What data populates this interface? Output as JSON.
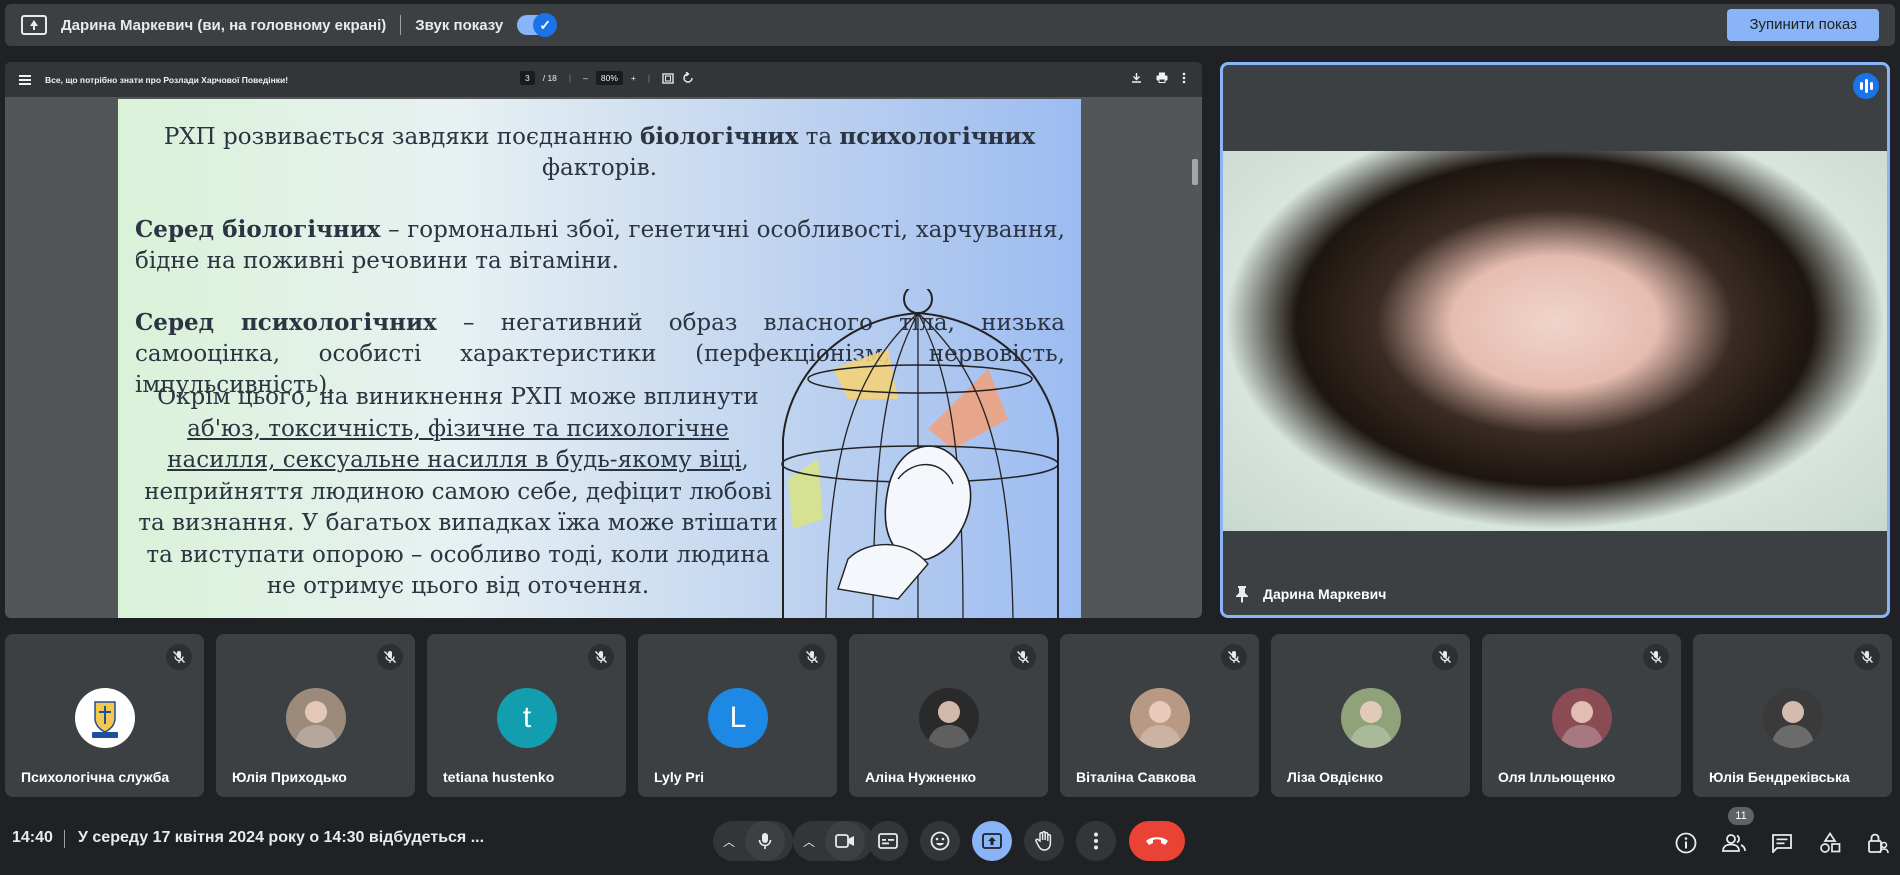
{
  "topbar": {
    "presenter": "Дарина Маркевич (ви, на головному екрані)",
    "sound_label": "Звук показу",
    "stop_label": "Зупинити показ"
  },
  "pdf": {
    "title": "Все, що потрібно знати про Розлади Харчової Поведінки!",
    "page_current": "3",
    "page_total": "/ 18",
    "zoom": "80%",
    "minus": "–",
    "plus": "+",
    "content": {
      "p1_a": "РХП розвивається завдяки поєднанню ",
      "p1_b": "біологічних",
      "p1_c": " та ",
      "p1_d": "психологічних",
      "p1_e": "факторів.",
      "p2_bold": "Серед біологічних",
      "p2_rest": " – гормональні збої, генетичні особливості, харчування, бідне на поживні речовини та вітаміни.",
      "p3_bold": "Серед психологічних",
      "p3_rest": " – негативний образ власного тіла, низька самооцінка, особисті характеристики (перфекціонізм, нервовість, імпульсивність).",
      "p4_a": "Окрім цього, на виникнення РХП може вплинути ",
      "p4_u": "аб'юз, токсичність, фізичне та психологічне насилля, сексуальне насилля в будь-якому віці",
      "p4_b": ", неприйняття людиною самою себе, дефіцит любові та визнання. У багатьох випадках їжа може втішати та виступати опорою – особливо тоді, коли людина не отримує цього від оточення."
    }
  },
  "speaker": {
    "name": "Дарина Маркевич"
  },
  "participants": [
    {
      "name": "Психологічна служба",
      "initial": "",
      "color": "#ffffff"
    },
    {
      "name": "Юлія Приходько",
      "initial": "",
      "color": "#9c8a7a"
    },
    {
      "name": "tetiana hustenko",
      "initial": "t",
      "color": "#129eaf"
    },
    {
      "name": "Lyly Pri",
      "initial": "L",
      "color": "#1e88e5"
    },
    {
      "name": "Аліна Нужненко",
      "initial": "",
      "color": "#2a2a2a"
    },
    {
      "name": "Віталіна Савкова",
      "initial": "",
      "color": "#b89a84"
    },
    {
      "name": "Ліза Овдієнко",
      "initial": "",
      "color": "#8fa27a"
    },
    {
      "name": "Оля Ілльющенко",
      "initial": "",
      "color": "#8a4b55"
    },
    {
      "name": "Юлія Бендреківська",
      "initial": "",
      "color": "#3a3a3a"
    }
  ],
  "bottom": {
    "time": "14:40",
    "meeting_title": "У середу 17 квітня 2024 року о 14:30 відбудеться ...",
    "participant_count": "11"
  },
  "colors": {
    "accent": "#8ab4f8",
    "hangup": "#ea4335",
    "surface": "#3c4043",
    "background": "#202124"
  }
}
